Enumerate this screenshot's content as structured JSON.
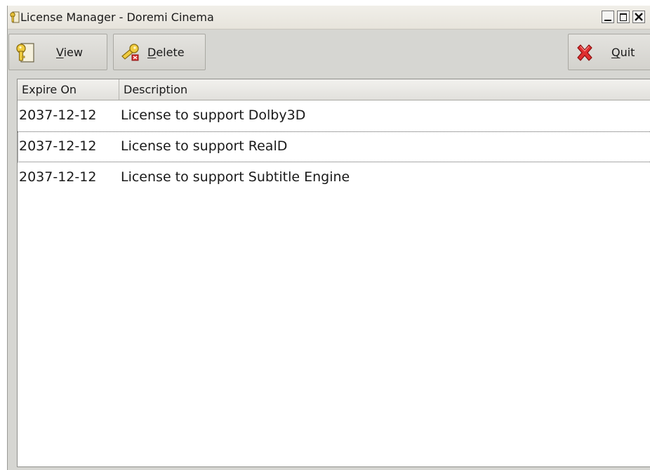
{
  "window": {
    "title": "License Manager - Doremi Cinema",
    "controls": [
      "minimize-icon",
      "maximize-icon",
      "close-icon"
    ]
  },
  "toolbar": {
    "view": {
      "label_mnemonic": "V",
      "label_rest": "iew",
      "icon": "key-icon"
    },
    "delete": {
      "label_mnemonic": "D",
      "label_rest": "elete",
      "icon": "delete-key-icon"
    },
    "quit": {
      "label_mnemonic": "Q",
      "label_rest": "uit",
      "icon": "red-x-icon"
    }
  },
  "table": {
    "columns": [
      "Expire On",
      "Description"
    ],
    "rows": [
      {
        "expire": "2037-12-12",
        "description": "License to support Dolby3D"
      },
      {
        "expire": "2037-12-12",
        "description": "License to support RealD"
      },
      {
        "expire": "2037-12-12",
        "description": "License to support Subtitle Engine"
      }
    ],
    "focused_row": 1
  },
  "colors": {
    "window_bg": "#d6d6d2",
    "list_bg": "#ffffff",
    "quit_icon": "#d42020",
    "key_icon": "#e8c23a"
  }
}
